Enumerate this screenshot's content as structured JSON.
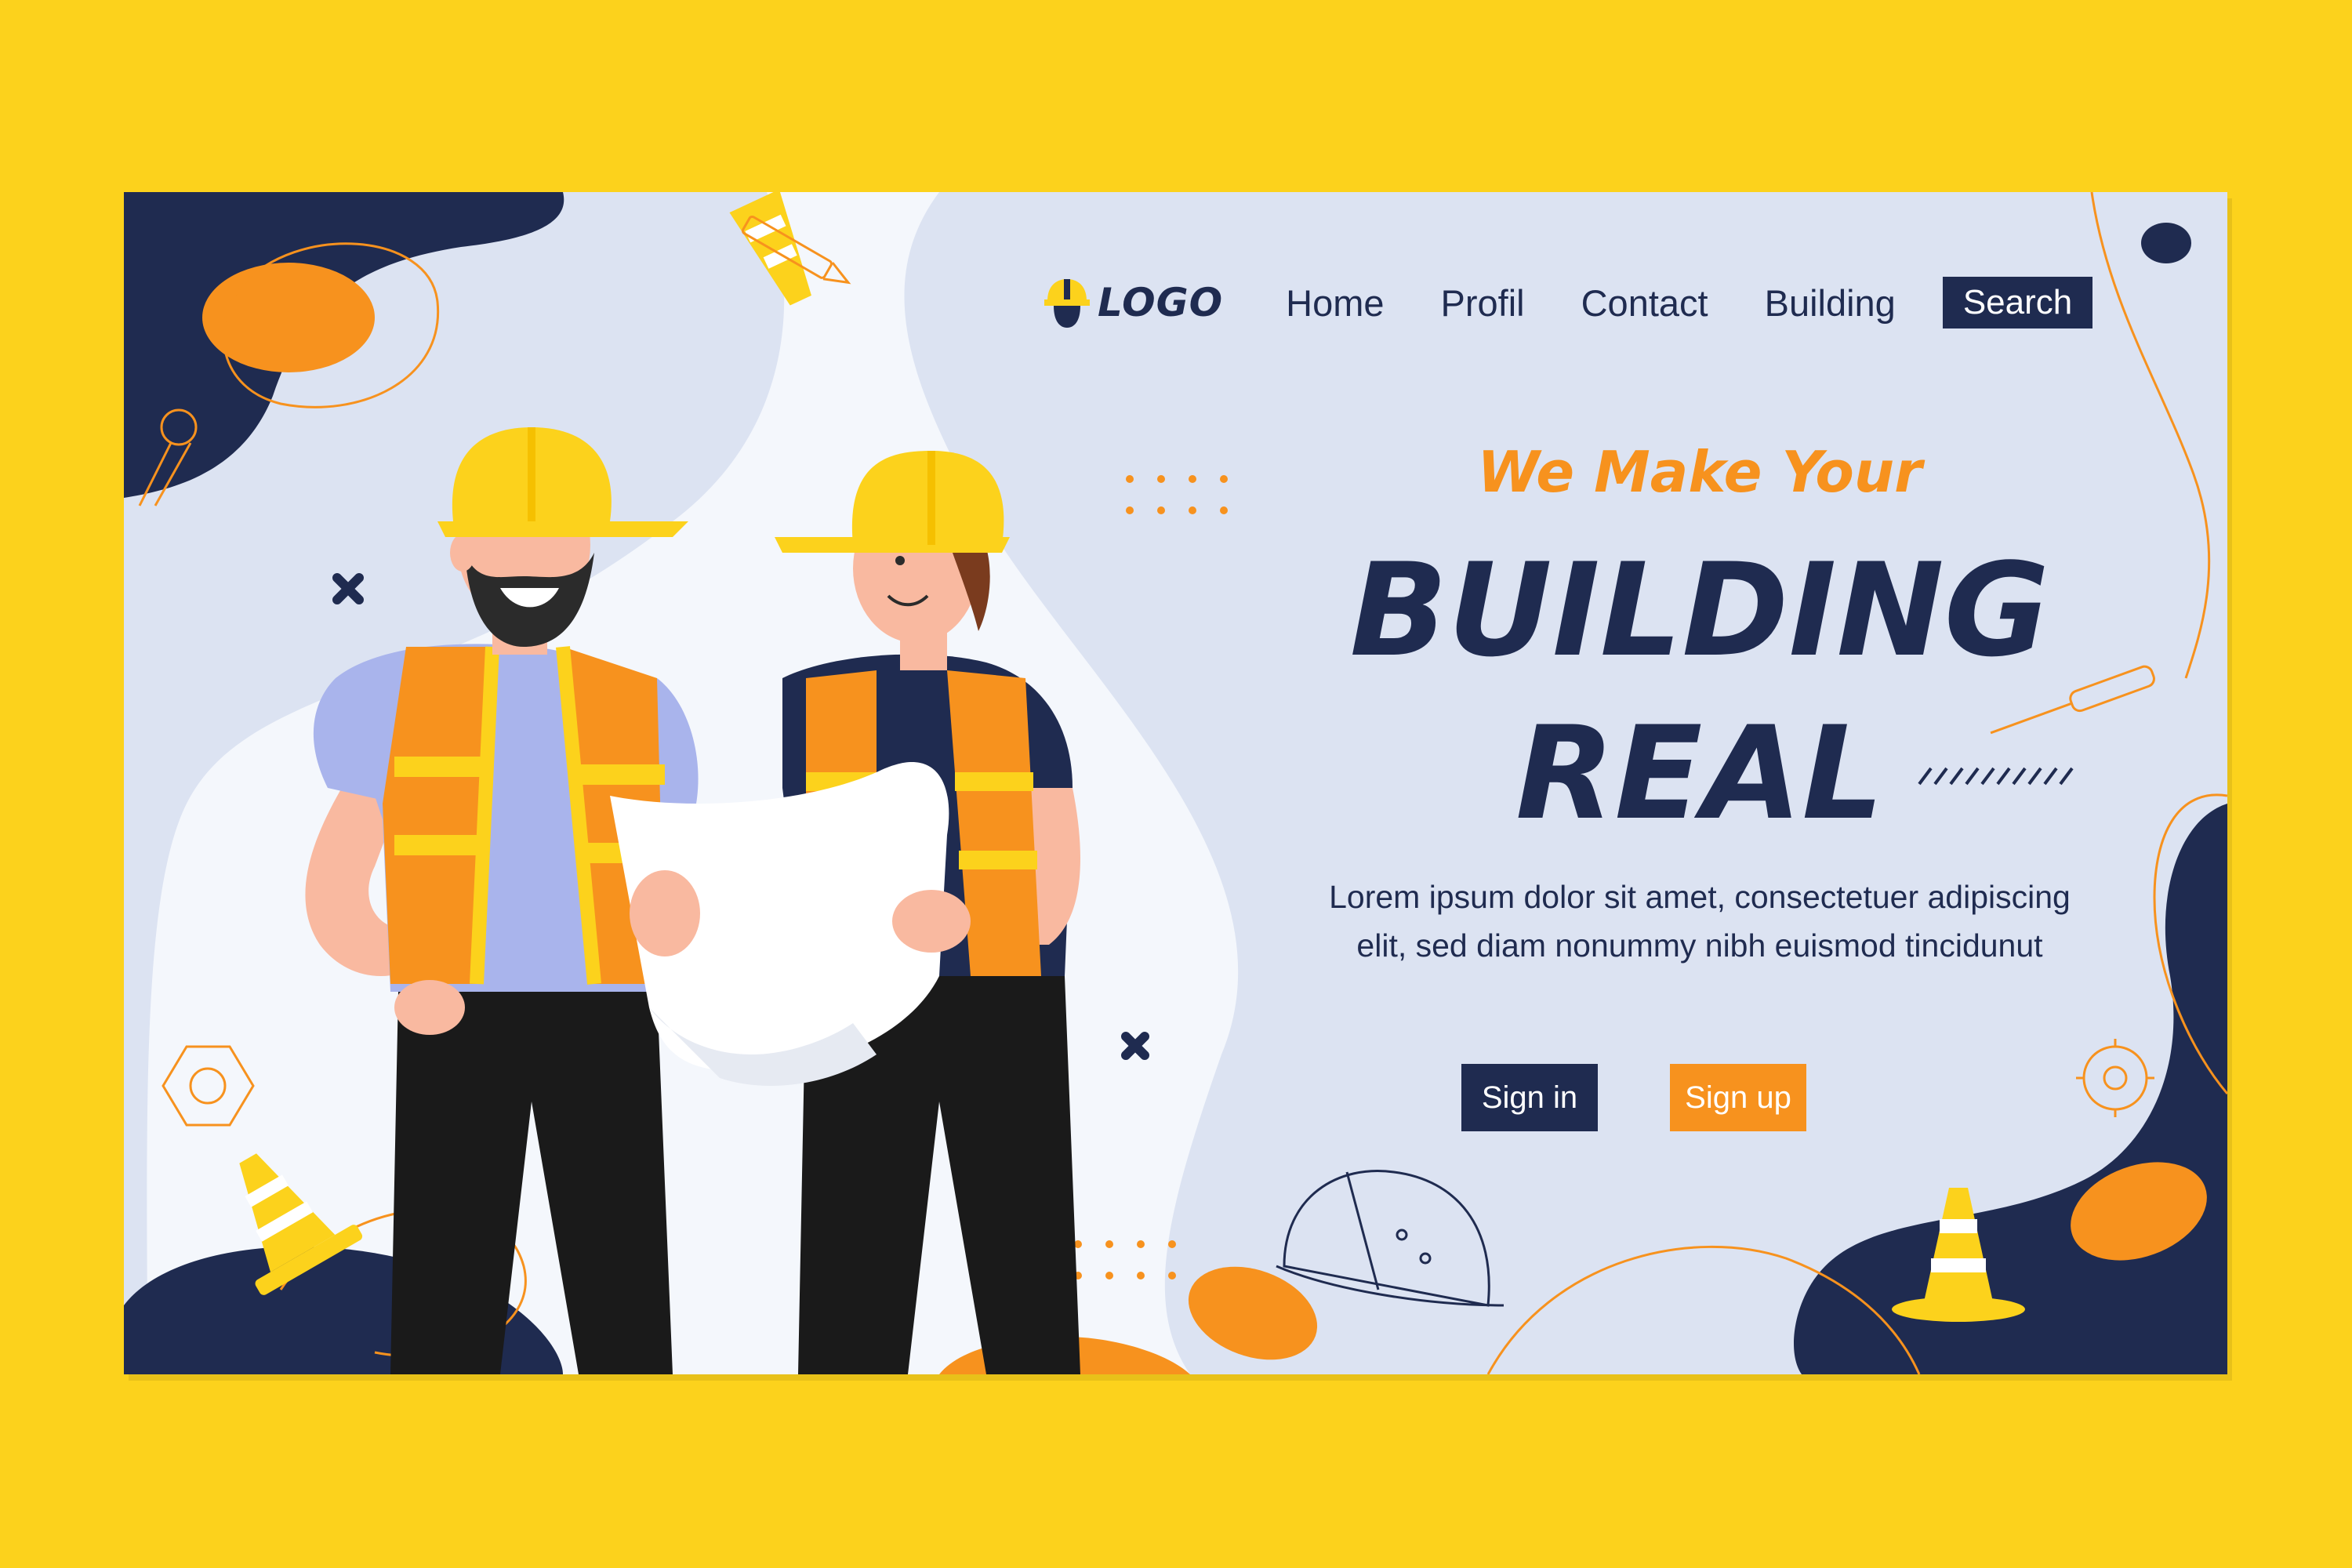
{
  "logo": {
    "text": "LOGO",
    "icon": "hard-hat-icon"
  },
  "nav": {
    "links": [
      "Home",
      "Profil",
      "Contact",
      "Building"
    ],
    "search_label": "Search"
  },
  "hero": {
    "tagline": "We Make Your",
    "headline_line1": "BUILDING",
    "headline_line2": "REAL",
    "body": "Lorem ipsum dolor sit amet, consectetuer adipiscing elit, sed diam nonummy nibh euismod tincidunut",
    "signin_label": "Sign in",
    "signup_label": "Sign up"
  },
  "colors": {
    "page_bg": "#FCD21C",
    "card_bg": "#DCE3F2",
    "navy": "#1F2B50",
    "orange": "#F7921E",
    "yellow": "#FCD21C"
  }
}
